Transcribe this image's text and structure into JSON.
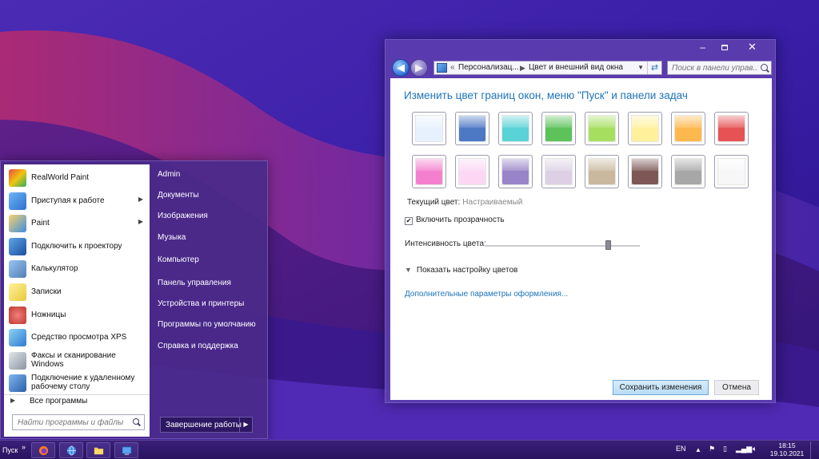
{
  "window": {
    "title_buttons": {
      "minimize": "–",
      "maximize": "",
      "close": "✕"
    },
    "address": {
      "overflow": "«",
      "crumb1": "Персонализац...",
      "crumb2": "Цвет и внешний вид окна",
      "search_placeholder": "Поиск в панели управ..."
    },
    "heading": "Изменить цвет границ окон, меню \"Пуск\" и панели задач",
    "swatches": [
      {
        "name": "sky",
        "color": "#e7f1fd"
      },
      {
        "name": "twilight",
        "color": "#4d78c4"
      },
      {
        "name": "sea",
        "color": "#59d3d6"
      },
      {
        "name": "leaf",
        "color": "#5cc259"
      },
      {
        "name": "lime",
        "color": "#a6df5f"
      },
      {
        "name": "lemon",
        "color": "#fff09c"
      },
      {
        "name": "tangerine",
        "color": "#ffb84d"
      },
      {
        "name": "ruby",
        "color": "#e65354"
      },
      {
        "name": "fuchsia",
        "color": "#f57fcf"
      },
      {
        "name": "blush",
        "color": "#fbd7f3"
      },
      {
        "name": "violet",
        "color": "#9884c8"
      },
      {
        "name": "lavender",
        "color": "#ddd0e5"
      },
      {
        "name": "taupe",
        "color": "#cab89e"
      },
      {
        "name": "chocolate",
        "color": "#7c5756"
      },
      {
        "name": "slate",
        "color": "#a7a7a7"
      },
      {
        "name": "frost",
        "color": "#f7f7f7"
      }
    ],
    "current_color_label": "Текущий цвет:",
    "current_color_value": "Настраиваемый",
    "transparency_label": "Включить прозрачность",
    "transparency_checked": true,
    "transparency_check": "✔",
    "intensity_label": "Интенсивность цвета:",
    "intensity_value": 0.8,
    "show_mixer_label": "Показать настройку цветов",
    "advanced_link": "Дополнительные параметры оформления...",
    "save_label": "Сохранить изменения",
    "cancel_label": "Отмена"
  },
  "start_menu": {
    "programs": [
      {
        "label": "RealWorld Paint",
        "icon": "paint-palette-icon",
        "submenu": false
      },
      {
        "label": "Приступая к работе",
        "icon": "getting-started-icon",
        "submenu": true
      },
      {
        "label": "Paint",
        "icon": "paint-icon",
        "submenu": true
      },
      {
        "label": "Подключить к проектору",
        "icon": "projector-icon",
        "submenu": false
      },
      {
        "label": "Калькулятор",
        "icon": "calculator-icon",
        "submenu": false
      },
      {
        "label": "Записки",
        "icon": "sticky-notes-icon",
        "submenu": false
      },
      {
        "label": "Ножницы",
        "icon": "scissors-icon",
        "submenu": false
      },
      {
        "label": "Средство просмотра XPS",
        "icon": "xps-viewer-icon",
        "submenu": false
      },
      {
        "label": "Факсы и сканирование Windows",
        "icon": "fax-scan-icon",
        "submenu": false
      },
      {
        "label": "Подключение к удаленному рабочему столу",
        "icon": "remote-desktop-icon",
        "submenu": false
      }
    ],
    "submenu_arrow": "▶",
    "all_programs": "Все программы",
    "search_placeholder": "Найти программы и файлы",
    "places": [
      "Admin",
      "Документы",
      "Изображения",
      "Музыка",
      "Компьютер",
      "Панель управления",
      "Устройства и принтеры",
      "Программы по умолчанию",
      "Справка и поддержка"
    ],
    "shutdown_label": "Завершение работы"
  },
  "taskbar": {
    "start_label": "Пуск",
    "more": "»",
    "apps": [
      {
        "name": "firefox",
        "icon": "firefox-icon"
      },
      {
        "name": "browser",
        "icon": "globe-icon"
      },
      {
        "name": "explorer",
        "icon": "folder-icon"
      },
      {
        "name": "control-panel",
        "icon": "control-panel-icon"
      }
    ],
    "language": "EN",
    "time": "18:15",
    "date": "19.10.2021"
  }
}
